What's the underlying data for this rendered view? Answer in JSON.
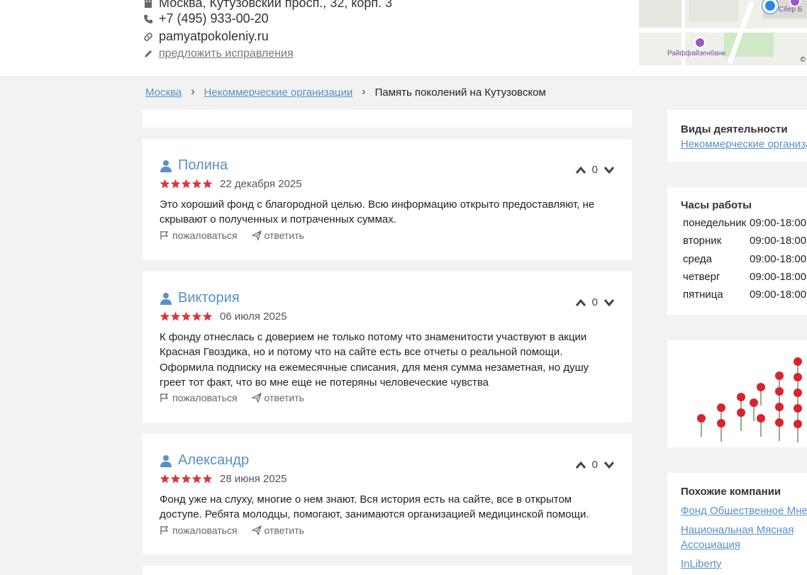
{
  "org": {
    "address": "Москва, Кутузовский просп., 32, корп. 3",
    "phone": "+7 (495) 933-00-20",
    "website": "pamyatpokoleniy.ru",
    "suggest_edit": "предложить исправления"
  },
  "map": {
    "labels": [
      "Сбер Б",
      "Райффайзенбанк"
    ],
    "copyright": "©"
  },
  "breadcrumbs": [
    {
      "label": "Москва"
    },
    {
      "label": "Некоммерческие организации"
    },
    {
      "label": "Память поколений на Кутузовском"
    }
  ],
  "reviews": [
    {
      "author": "Полина",
      "stars": 5,
      "date": "22 декабря 2025",
      "votes": "0",
      "text": "Это хороший фонд с благородной целью. Всю информацию открыто предоставляют, не скрывают о полученных и потраченных суммах."
    },
    {
      "author": "Виктория",
      "stars": 5,
      "date": "06 июля 2025",
      "votes": "0",
      "text": "К фонду отнеслась с доверием не только потому что знаменитости участвуют в акции Красная Гвоздика, но и потому что на сайте есть все отчеты о реальной помощи. Оформила подписку на ежемесячные списания, для меня сумма незаметная, но душу греет тот факт, что во мне еще не потеряны человеческие чувства"
    },
    {
      "author": "Александр",
      "stars": 5,
      "date": "28 июня 2025",
      "votes": "0",
      "text": "Фонд уже на слуху, многие о нем знают. Вся история есть на сайте, все в открытом доступе. Ребята молодцы, помогают, занимаются организацией медицинской помощи."
    }
  ],
  "review_actions": {
    "complain": "пожаловаться",
    "reply": "ответить"
  },
  "sidebar": {
    "activities_title": "Виды деятельности",
    "activity": "Некоммерческие организации",
    "hours_title": "Часы работы",
    "hours": [
      {
        "day": "понедельник",
        "time": "09:00-18:00"
      },
      {
        "day": "вторник",
        "time": "09:00-18:00"
      },
      {
        "day": "среда",
        "time": "09:00-18:00"
      },
      {
        "day": "четверг",
        "time": "09:00-18:00"
      },
      {
        "day": "пятница",
        "time": "09:00-18:00"
      }
    ],
    "similar_title": "Похожие компании",
    "similar": [
      "Фонд Общественное Мнение",
      "Национальная Мясная",
      "Ассоциация",
      "InLiberty"
    ]
  },
  "colors": {
    "link": "#5b8fc7",
    "star": "#d9363e",
    "background": "#f2f2f2"
  }
}
